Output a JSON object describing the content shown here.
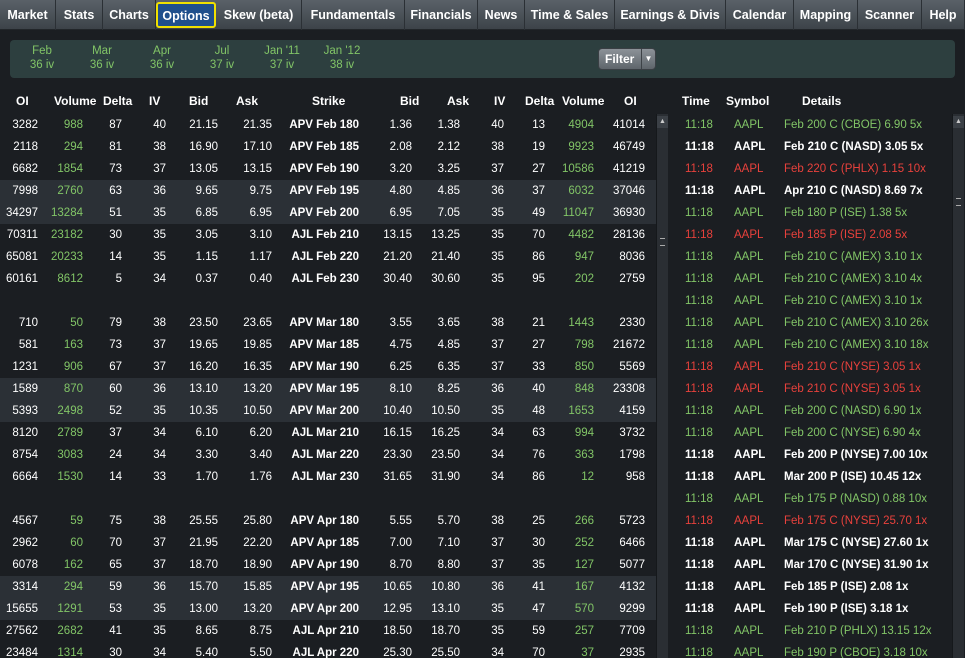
{
  "nav": {
    "tabs": [
      {
        "label": "Market",
        "w": 56
      },
      {
        "label": "Stats",
        "w": 47
      },
      {
        "label": "Charts",
        "w": 53
      },
      {
        "label": "Options",
        "w": 60,
        "active": true
      },
      {
        "label": "Skew (beta)",
        "w": 86
      },
      {
        "label": "Fundamentals",
        "w": 103
      },
      {
        "label": "Financials",
        "w": 73
      },
      {
        "label": "News",
        "w": 47
      },
      {
        "label": "Time & Sales",
        "w": 90
      },
      {
        "label": "Earnings & Divis",
        "w": 111
      },
      {
        "label": "Calendar",
        "w": 68
      },
      {
        "label": "Mapping",
        "w": 64
      },
      {
        "label": "Scanner",
        "w": 64
      },
      {
        "label": "Help",
        "w": 43
      }
    ]
  },
  "expiries": [
    {
      "month": "Feb",
      "iv": "36 iv"
    },
    {
      "month": "Mar",
      "iv": "36 iv"
    },
    {
      "month": "Apr",
      "iv": "36 iv"
    },
    {
      "month": "Jul",
      "iv": "37 iv"
    },
    {
      "month": "Jan '11",
      "iv": "37 iv"
    },
    {
      "month": "Jan '12",
      "iv": "38 iv"
    }
  ],
  "filter_label": "Filter",
  "headers": {
    "calls": [
      "OI",
      "Volume",
      "Delta",
      "IV",
      "Bid",
      "Ask"
    ],
    "strike": "Strike",
    "puts": [
      "Bid",
      "Ask",
      "IV",
      "Delta",
      "Volume",
      "OI"
    ],
    "tns": [
      "Time",
      "Symbol",
      "Details"
    ]
  },
  "chain": [
    {
      "c": [
        "3282",
        "988",
        "87",
        "40",
        "21.15",
        "21.35"
      ],
      "strike": "APV Feb 180",
      "p": [
        "1.36",
        "1.38",
        "40",
        "13",
        "4904",
        "41014"
      ]
    },
    {
      "c": [
        "2118",
        "294",
        "81",
        "38",
        "16.90",
        "17.10"
      ],
      "strike": "APV Feb 185",
      "p": [
        "2.08",
        "2.12",
        "38",
        "19",
        "9923",
        "46749"
      ]
    },
    {
      "c": [
        "6682",
        "1854",
        "73",
        "37",
        "13.05",
        "13.15"
      ],
      "strike": "APV Feb 190",
      "p": [
        "3.20",
        "3.25",
        "37",
        "27",
        "10586",
        "41219"
      ]
    },
    {
      "c": [
        "7998",
        "2760",
        "63",
        "36",
        "9.65",
        "9.75"
      ],
      "strike": "APV Feb 195",
      "p": [
        "4.80",
        "4.85",
        "36",
        "37",
        "6032",
        "37046"
      ]
    },
    {
      "c": [
        "34297",
        "13284",
        "51",
        "35",
        "6.85",
        "6.95"
      ],
      "strike": "APV Feb 200",
      "p": [
        "6.95",
        "7.05",
        "35",
        "49",
        "11047",
        "36930"
      ]
    },
    {
      "c": [
        "70311",
        "23182",
        "30",
        "35",
        "3.05",
        "3.10"
      ],
      "strike": "AJL Feb 210",
      "p": [
        "13.15",
        "13.25",
        "35",
        "70",
        "4482",
        "28136"
      ]
    },
    {
      "c": [
        "65081",
        "20233",
        "14",
        "35",
        "1.15",
        "1.17"
      ],
      "strike": "AJL Feb 220",
      "p": [
        "21.20",
        "21.40",
        "35",
        "86",
        "947",
        "8036"
      ]
    },
    {
      "c": [
        "60161",
        "8612",
        "5",
        "34",
        "0.37",
        "0.40"
      ],
      "strike": "AJL Feb 230",
      "p": [
        "30.40",
        "30.60",
        "35",
        "95",
        "202",
        "2759"
      ]
    },
    null,
    {
      "c": [
        "710",
        "50",
        "79",
        "38",
        "23.50",
        "23.65"
      ],
      "strike": "APV Mar 180",
      "p": [
        "3.55",
        "3.65",
        "38",
        "21",
        "1443",
        "2330"
      ]
    },
    {
      "c": [
        "581",
        "163",
        "73",
        "37",
        "19.65",
        "19.85"
      ],
      "strike": "APV Mar 185",
      "p": [
        "4.75",
        "4.85",
        "37",
        "27",
        "798",
        "21672"
      ]
    },
    {
      "c": [
        "1231",
        "906",
        "67",
        "37",
        "16.20",
        "16.35"
      ],
      "strike": "APV Mar 190",
      "p": [
        "6.25",
        "6.35",
        "37",
        "33",
        "850",
        "5569"
      ]
    },
    {
      "c": [
        "1589",
        "870",
        "60",
        "36",
        "13.10",
        "13.20"
      ],
      "strike": "APV Mar 195",
      "p": [
        "8.10",
        "8.25",
        "36",
        "40",
        "848",
        "23308"
      ]
    },
    {
      "c": [
        "5393",
        "2498",
        "52",
        "35",
        "10.35",
        "10.50"
      ],
      "strike": "APV Mar 200",
      "p": [
        "10.40",
        "10.50",
        "35",
        "48",
        "1653",
        "4159"
      ]
    },
    {
      "c": [
        "8120",
        "2789",
        "37",
        "34",
        "6.10",
        "6.20"
      ],
      "strike": "AJL Mar 210",
      "p": [
        "16.15",
        "16.25",
        "34",
        "63",
        "994",
        "3732"
      ]
    },
    {
      "c": [
        "8754",
        "3083",
        "24",
        "34",
        "3.30",
        "3.40"
      ],
      "strike": "AJL Mar 220",
      "p": [
        "23.30",
        "23.50",
        "34",
        "76",
        "363",
        "1798"
      ]
    },
    {
      "c": [
        "6664",
        "1530",
        "14",
        "33",
        "1.70",
        "1.76"
      ],
      "strike": "AJL Mar 230",
      "p": [
        "31.65",
        "31.90",
        "34",
        "86",
        "12",
        "958"
      ]
    },
    null,
    {
      "c": [
        "4567",
        "59",
        "75",
        "38",
        "25.55",
        "25.80"
      ],
      "strike": "APV Apr 180",
      "p": [
        "5.55",
        "5.70",
        "38",
        "25",
        "266",
        "5723"
      ]
    },
    {
      "c": [
        "2962",
        "60",
        "70",
        "37",
        "21.95",
        "22.20"
      ],
      "strike": "APV Apr 185",
      "p": [
        "7.00",
        "7.10",
        "37",
        "30",
        "252",
        "6466"
      ]
    },
    {
      "c": [
        "6078",
        "162",
        "65",
        "37",
        "18.70",
        "18.90"
      ],
      "strike": "APV Apr 190",
      "p": [
        "8.70",
        "8.80",
        "37",
        "35",
        "127",
        "5077"
      ]
    },
    {
      "c": [
        "3314",
        "294",
        "59",
        "36",
        "15.70",
        "15.85"
      ],
      "strike": "APV Apr 195",
      "p": [
        "10.65",
        "10.80",
        "36",
        "41",
        "167",
        "4132"
      ]
    },
    {
      "c": [
        "15655",
        "1291",
        "53",
        "35",
        "13.00",
        "13.20"
      ],
      "strike": "APV Apr 200",
      "p": [
        "12.95",
        "13.10",
        "35",
        "47",
        "570",
        "9299"
      ]
    },
    {
      "c": [
        "27562",
        "2682",
        "41",
        "35",
        "8.65",
        "8.75"
      ],
      "strike": "AJL Apr 210",
      "p": [
        "18.50",
        "18.70",
        "35",
        "59",
        "257",
        "7709"
      ]
    },
    {
      "c": [
        "23484",
        "1314",
        "30",
        "34",
        "5.40",
        "5.50"
      ],
      "strike": "AJL Apr 220",
      "p": [
        "25.30",
        "25.50",
        "34",
        "70",
        "37",
        "2935"
      ]
    }
  ],
  "tns": [
    {
      "time": "11:18",
      "symbol": "AAPL",
      "details": "Feb 200 C (CBOE) 6.90 5x",
      "color": "green"
    },
    {
      "time": "11:18",
      "symbol": "AAPL",
      "details": "Feb 210 C (NASD) 3.05 5x",
      "color": "white"
    },
    {
      "time": "11:18",
      "symbol": "AAPL",
      "details": "Feb 220 C (PHLX) 1.15 10x",
      "color": "red"
    },
    {
      "time": "11:18",
      "symbol": "AAPL",
      "details": "Apr 210 C (NASD) 8.69 7x",
      "color": "white"
    },
    {
      "time": "11:18",
      "symbol": "AAPL",
      "details": "Feb 180 P (ISE) 1.38 5x",
      "color": "green"
    },
    {
      "time": "11:18",
      "symbol": "AAPL",
      "details": "Feb 185 P (ISE) 2.08 5x",
      "color": "red"
    },
    {
      "time": "11:18",
      "symbol": "AAPL",
      "details": "Feb 210 C (AMEX) 3.10 1x",
      "color": "green"
    },
    {
      "time": "11:18",
      "symbol": "AAPL",
      "details": "Feb 210 C (AMEX) 3.10 4x",
      "color": "green"
    },
    {
      "time": "11:18",
      "symbol": "AAPL",
      "details": "Feb 210 C (AMEX) 3.10 1x",
      "color": "green"
    },
    {
      "time": "11:18",
      "symbol": "AAPL",
      "details": "Feb 210 C (AMEX) 3.10 26x",
      "color": "green"
    },
    {
      "time": "11:18",
      "symbol": "AAPL",
      "details": "Feb 210 C (AMEX) 3.10 18x",
      "color": "green"
    },
    {
      "time": "11:18",
      "symbol": "AAPL",
      "details": "Feb 210 C (NYSE) 3.05 1x",
      "color": "red"
    },
    {
      "time": "11:18",
      "symbol": "AAPL",
      "details": "Feb 210 C (NYSE) 3.05 1x",
      "color": "red"
    },
    {
      "time": "11:18",
      "symbol": "AAPL",
      "details": "Feb 200 C (NASD) 6.90 1x",
      "color": "green"
    },
    {
      "time": "11:18",
      "symbol": "AAPL",
      "details": "Feb 200 C (NYSE) 6.90 4x",
      "color": "green"
    },
    {
      "time": "11:18",
      "symbol": "AAPL",
      "details": "Feb 200 P (NYSE) 7.00 10x",
      "color": "white"
    },
    {
      "time": "11:18",
      "symbol": "AAPL",
      "details": "Mar 200 P (ISE) 10.45 12x",
      "color": "white"
    },
    {
      "time": "11:18",
      "symbol": "AAPL",
      "details": "Feb 175 P (NASD) 0.88 10x",
      "color": "green"
    },
    {
      "time": "11:18",
      "symbol": "AAPL",
      "details": "Feb 175 C (NYSE) 25.70 1x",
      "color": "red"
    },
    {
      "time": "11:18",
      "symbol": "AAPL",
      "details": "Mar 175 C (NYSE) 27.60 1x",
      "color": "white"
    },
    {
      "time": "11:18",
      "symbol": "AAPL",
      "details": "Mar 170 C (NYSE) 31.90 1x",
      "color": "white"
    },
    {
      "time": "11:18",
      "symbol": "AAPL",
      "details": "Feb 185 P (ISE) 2.08 1x",
      "color": "white"
    },
    {
      "time": "11:18",
      "symbol": "AAPL",
      "details": "Feb 190 P (ISE) 3.18 1x",
      "color": "white"
    },
    {
      "time": "11:18",
      "symbol": "AAPL",
      "details": "Feb 210 P (PHLX) 13.15 12x",
      "color": "green"
    },
    {
      "time": "11:18",
      "symbol": "AAPL",
      "details": "Feb 190 P (CBOE) 3.18 10x",
      "color": "green"
    }
  ],
  "colors": {
    "up": "#82c567",
    "down": "#e8413c",
    "active_tab": "#1f4f8c",
    "active_outline": "#f0e000"
  }
}
